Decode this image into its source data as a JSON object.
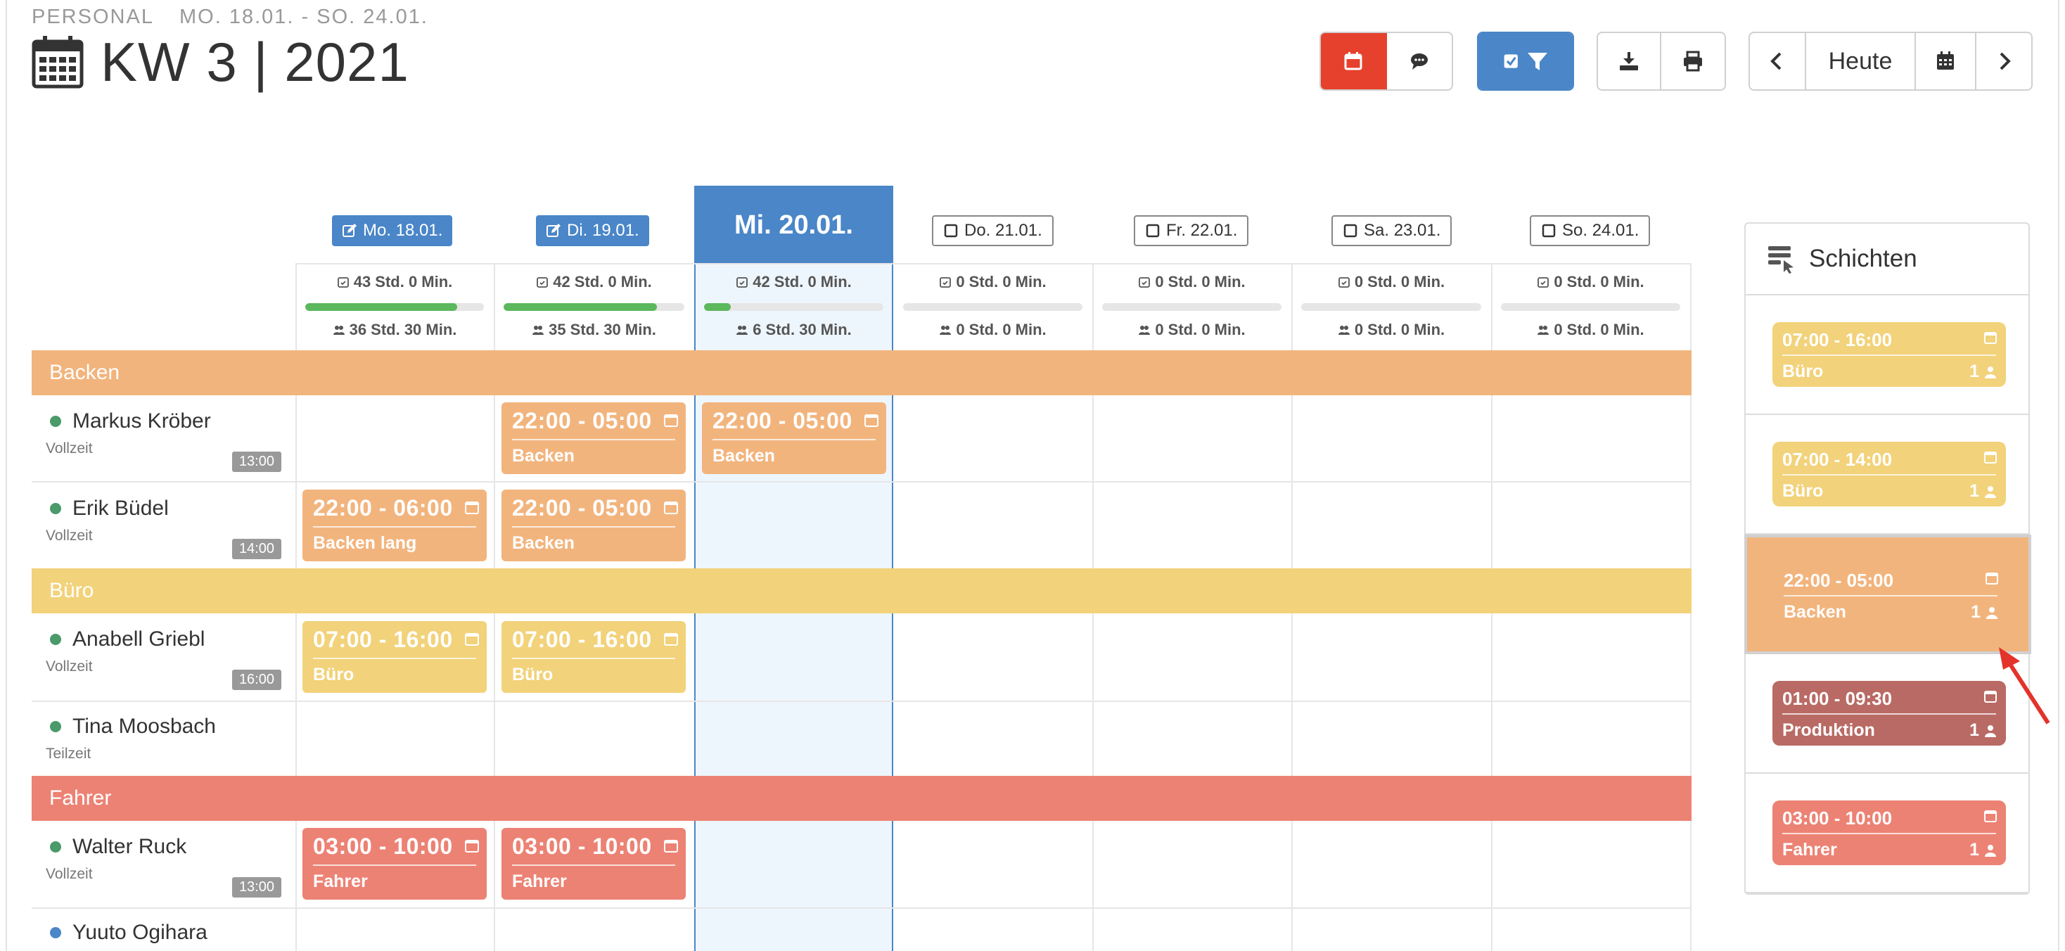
{
  "header": {
    "section": "PERSONAL",
    "range": "MO. 18.01. - SO. 24.01.",
    "title": "KW 3 | 2021"
  },
  "toolbar": {
    "today_label": "Heute",
    "colors": {
      "red": "#e5412d",
      "blue": "#4a86c8"
    }
  },
  "days": [
    {
      "label": "Mo. 18.01.",
      "state": "edit",
      "planned": "43 Std. 0 Min.",
      "progress": 0.85,
      "staff": "36 Std. 30 Min."
    },
    {
      "label": "Di. 19.01.",
      "state": "edit",
      "planned": "42 Std. 0 Min.",
      "progress": 0.85,
      "staff": "35 Std. 30 Min."
    },
    {
      "label": "Mi. 20.01.",
      "state": "today",
      "planned": "42 Std. 0 Min.",
      "progress": 0.15,
      "staff": "6 Std. 30 Min."
    },
    {
      "label": "Do. 21.01.",
      "state": "open",
      "planned": "0 Std. 0 Min.",
      "progress": 0,
      "staff": "0 Std. 0 Min."
    },
    {
      "label": "Fr. 22.01.",
      "state": "open",
      "planned": "0 Std. 0 Min.",
      "progress": 0,
      "staff": "0 Std. 0 Min."
    },
    {
      "label": "Sa. 23.01.",
      "state": "open",
      "planned": "0 Std. 0 Min.",
      "progress": 0,
      "staff": "0 Std. 0 Min."
    },
    {
      "label": "So. 24.01.",
      "state": "open",
      "planned": "0 Std. 0 Min.",
      "progress": 0,
      "staff": "0 Std. 0 Min."
    }
  ],
  "groups": [
    {
      "name": "Backen",
      "color": "#f2b47d"
    },
    {
      "name": "Büro",
      "color": "#f2d27a"
    },
    {
      "name": "Fahrer",
      "color": "#ec8274"
    }
  ],
  "employees": [
    {
      "name": "Markus Kröber",
      "type": "Vollzeit",
      "hours": "13:00",
      "dot": "#4a9a6a"
    },
    {
      "name": "Erik Büdel",
      "type": "Vollzeit",
      "hours": "14:00",
      "dot": "#4a9a6a"
    },
    {
      "name": "Anabell Griebl",
      "type": "Vollzeit",
      "hours": "16:00",
      "dot": "#4a9a6a"
    },
    {
      "name": "Tina Moosbach",
      "type": "Teilzeit",
      "hours": "",
      "dot": "#4a9a6a"
    },
    {
      "name": "Walter Ruck",
      "type": "Vollzeit",
      "hours": "13:00",
      "dot": "#4a9a6a"
    },
    {
      "name": "Yuuto Ogihara",
      "type": "",
      "hours": "",
      "dot": "#4a86c8"
    }
  ],
  "shifts": [
    {
      "time": "22:00 - 05:00",
      "label": "Backen",
      "color": "#f2b47d"
    },
    {
      "time": "22:00 - 05:00",
      "label": "Backen",
      "color": "#f2b47d"
    },
    {
      "time": "22:00 - 06:00",
      "label": "Backen lang",
      "color": "#f2b47d"
    },
    {
      "time": "22:00 - 05:00",
      "label": "Backen",
      "color": "#f2b47d"
    },
    {
      "time": "07:00 - 16:00",
      "label": "Büro",
      "color": "#f2d27a"
    },
    {
      "time": "07:00 - 16:00",
      "label": "Büro",
      "color": "#f2d27a"
    },
    {
      "time": "03:00 - 10:00",
      "label": "Fahrer",
      "color": "#ec8274"
    },
    {
      "time": "03:00 - 10:00",
      "label": "Fahrer",
      "color": "#ec8274"
    }
  ],
  "panel": {
    "title": "Schichten",
    "templates": [
      {
        "time": "07:00 - 16:00",
        "label": "Büro",
        "count": "1",
        "color": "#f2d27a"
      },
      {
        "time": "07:00 - 14:00",
        "label": "Büro",
        "count": "1",
        "color": "#f2d27a"
      },
      {
        "time": "22:00 - 05:00",
        "label": "Backen",
        "count": "1",
        "color": "#f2b47d"
      },
      {
        "time": "01:00 - 09:30",
        "label": "Produktion",
        "count": "1",
        "color": "#b96a64"
      },
      {
        "time": "03:00 - 10:00",
        "label": "Fahrer",
        "count": "1",
        "color": "#ec8274"
      }
    ]
  }
}
